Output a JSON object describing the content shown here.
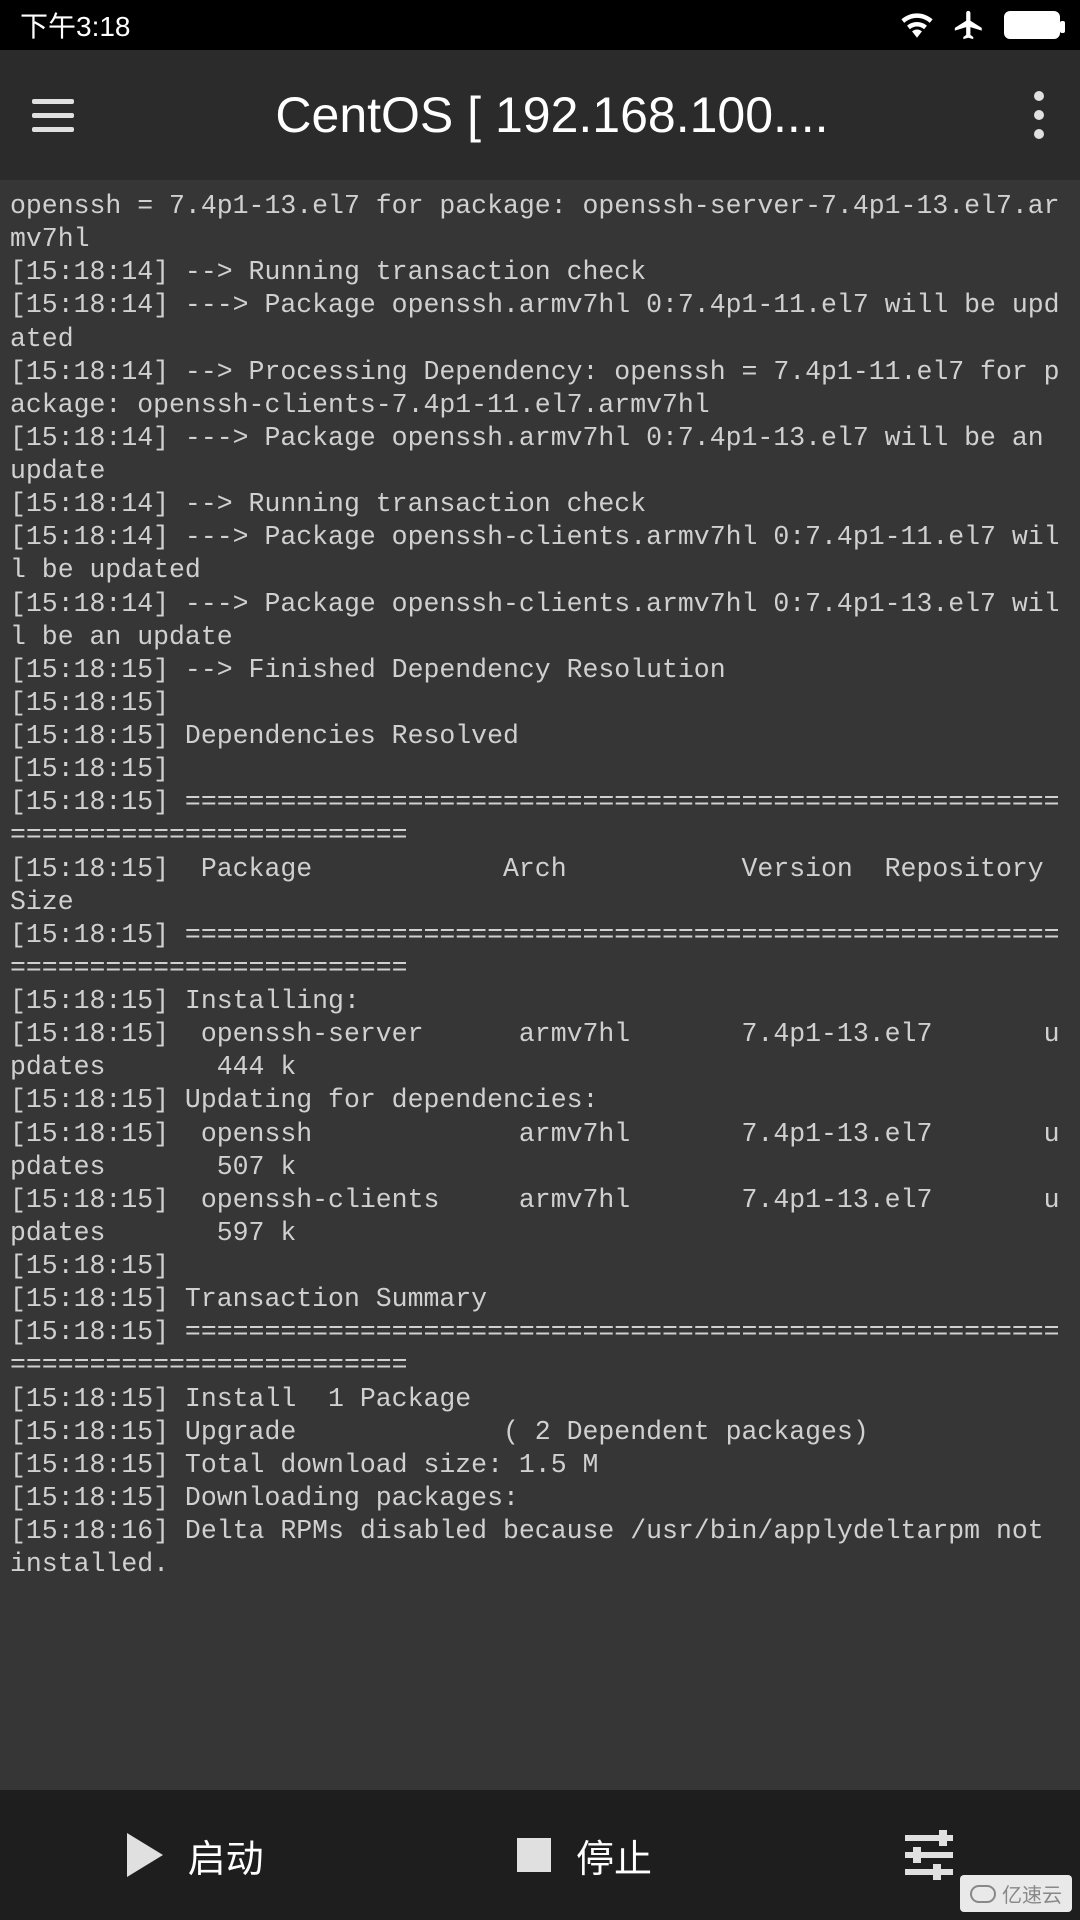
{
  "status": {
    "time": "下午3:18"
  },
  "header": {
    "title": "CentOS  [ 192.168.100...."
  },
  "terminal": {
    "lines": [
      "openssh = 7.4p1-13.el7 for package: openssh-server-7.4p1-13.el7.armv7hl",
      "[15:18:14] --> Running transaction check",
      "[15:18:14] ---> Package openssh.armv7hl 0:7.4p1-11.el7 will be updated",
      "[15:18:14] --> Processing Dependency: openssh = 7.4p1-11.el7 for package: openssh-clients-7.4p1-11.el7.armv7hl",
      "[15:18:14] ---> Package openssh.armv7hl 0:7.4p1-13.el7 will be an update",
      "[15:18:14] --> Running transaction check",
      "[15:18:14] ---> Package openssh-clients.armv7hl 0:7.4p1-11.el7 will be updated",
      "[15:18:14] ---> Package openssh-clients.armv7hl 0:7.4p1-13.el7 will be an update",
      "[15:18:15] --> Finished Dependency Resolution",
      "[15:18:15]",
      "[15:18:15] Dependencies Resolved",
      "[15:18:15]",
      "[15:18:15] ================================================================================",
      "[15:18:15]  Package            Arch           Version  Repository     Size",
      "[15:18:15] ================================================================================",
      "[15:18:15] Installing:",
      "[15:18:15]  openssh-server      armv7hl       7.4p1-13.el7       updates       444 k",
      "[15:18:15] Updating for dependencies:",
      "[15:18:15]  openssh             armv7hl       7.4p1-13.el7       updates       507 k",
      "[15:18:15]  openssh-clients     armv7hl       7.4p1-13.el7       updates       597 k",
      "[15:18:15]",
      "[15:18:15] Transaction Summary",
      "[15:18:15] ================================================================================",
      "[15:18:15] Install  1 Package",
      "[15:18:15] Upgrade             ( 2 Dependent packages)",
      "[15:18:15] Total download size: 1.5 M",
      "[15:18:15] Downloading packages:",
      "[15:18:16] Delta RPMs disabled because /usr/bin/applydeltarpm not installed."
    ]
  },
  "bottom": {
    "start": "启动",
    "stop": "停止"
  },
  "watermark": "亿速云"
}
